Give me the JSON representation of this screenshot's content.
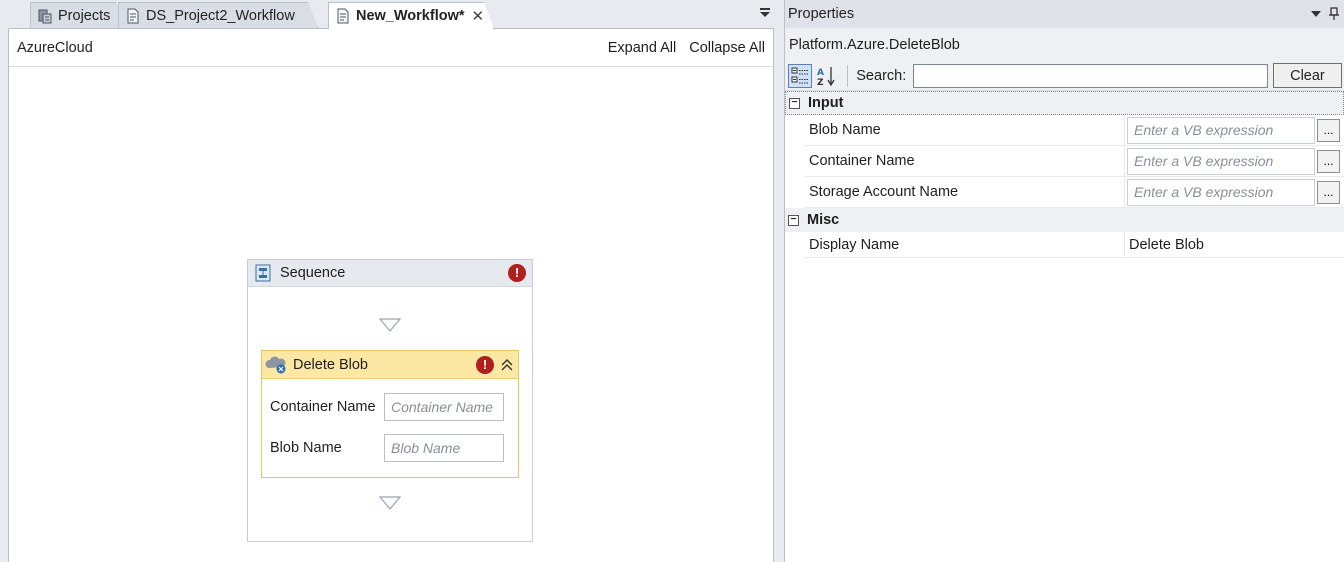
{
  "tabs": [
    {
      "label": "Projects",
      "icon": "projects-icon",
      "active": false
    },
    {
      "label": "DS_Project2_Workflow",
      "icon": "workflow-file-icon",
      "active": false
    },
    {
      "label": "New_Workflow*",
      "icon": "workflow-file-icon",
      "active": true,
      "close": "✕"
    }
  ],
  "designer": {
    "breadcrumb": "AzureCloud",
    "expand_all": "Expand All",
    "collapse_all": "Collapse All",
    "sequence": {
      "title": "Sequence",
      "error": "!",
      "activity": {
        "title": "Delete Blob",
        "error": "!",
        "fields": [
          {
            "label": "Container Name",
            "placeholder": "Container Name"
          },
          {
            "label": "Blob Name",
            "placeholder": "Blob Name"
          }
        ]
      }
    }
  },
  "properties": {
    "title": "Properties",
    "activity_type": "Platform.Azure.DeleteBlob",
    "search_label": "Search:",
    "search_value": "",
    "clear_label": "Clear",
    "categories": [
      {
        "name": "Input",
        "toggle": "−",
        "rows": [
          {
            "name": "Blob Name",
            "placeholder": "Enter a VB expression",
            "button": "..."
          },
          {
            "name": "Container Name",
            "placeholder": "Enter a VB expression",
            "button": "..."
          },
          {
            "name": "Storage Account Name",
            "placeholder": "Enter a VB expression",
            "button": "..."
          }
        ]
      },
      {
        "name": "Misc",
        "toggle": "−",
        "rows": [
          {
            "name": "Display Name",
            "value": "Delete Blob"
          }
        ]
      }
    ]
  },
  "colors": {
    "activity_header": "#fce8a3",
    "activity_border": "#e7c468",
    "error": "#b01e1e",
    "pane_background": "#e7eaee"
  }
}
